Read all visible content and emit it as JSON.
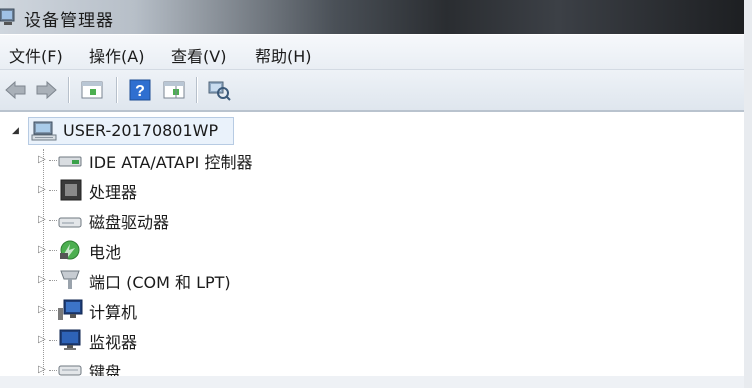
{
  "window": {
    "title": "设备管理器"
  },
  "menu": {
    "items": [
      {
        "label": "文件(F)"
      },
      {
        "label": "操作(A)"
      },
      {
        "label": "查看(V)"
      },
      {
        "label": "帮助(H)"
      }
    ]
  },
  "toolbar": {
    "buttons": [
      {
        "icon": "back-arrow-icon"
      },
      {
        "icon": "forward-arrow-icon"
      },
      {
        "icon": "properties-pane-icon"
      },
      {
        "icon": "help-icon"
      },
      {
        "icon": "action-pane-icon"
      },
      {
        "icon": "scan-hardware-icon"
      }
    ]
  },
  "tree": {
    "root": {
      "label": "USER-20170801WP",
      "icon": "computer-network-icon"
    },
    "nodes": [
      {
        "label": "IDE ATA/ATAPI 控制器",
        "icon": "ide-controller-icon"
      },
      {
        "label": "处理器",
        "icon": "processor-icon"
      },
      {
        "label": "磁盘驱动器",
        "icon": "disk-drive-icon"
      },
      {
        "label": "电池",
        "icon": "battery-icon"
      },
      {
        "label": "端口 (COM 和 LPT)",
        "icon": "port-icon"
      },
      {
        "label": "计算机",
        "icon": "computer-icon"
      },
      {
        "label": "监视器",
        "icon": "monitor-icon"
      },
      {
        "label": "键盘",
        "icon": "keyboard-icon"
      }
    ]
  },
  "colors": {
    "selection_bg": "#eaf2fb",
    "selection_border": "#b7cbe3",
    "help_blue": "#2f6fd0"
  }
}
